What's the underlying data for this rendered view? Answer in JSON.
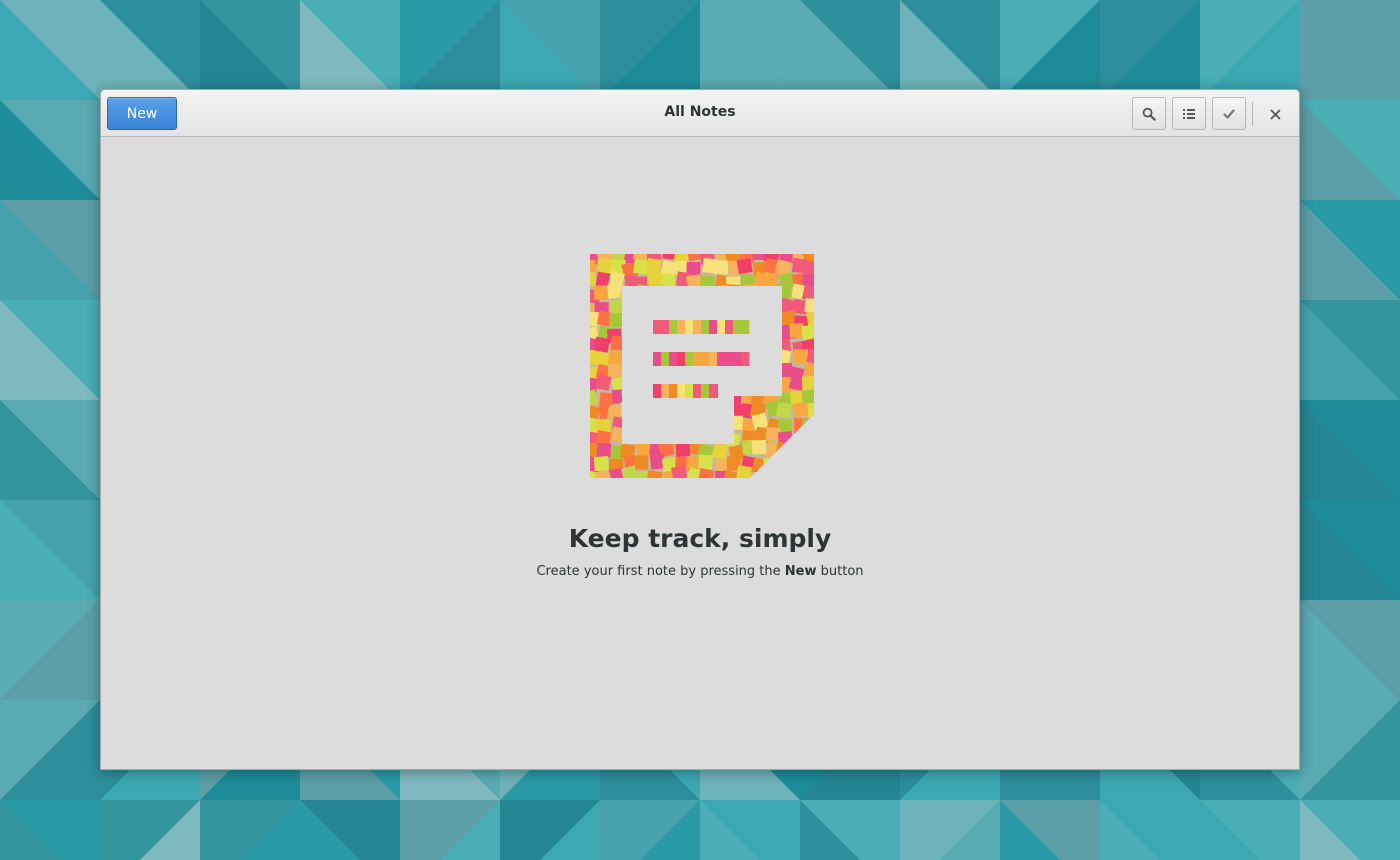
{
  "window": {
    "title": "All Notes"
  },
  "headerbar": {
    "new_label": "New",
    "buttons": [
      {
        "id": "search",
        "icon": "search-icon"
      },
      {
        "id": "view",
        "icon": "list-view-icon"
      },
      {
        "id": "select",
        "icon": "checkmark-icon"
      },
      {
        "id": "close",
        "icon": "close-icon"
      }
    ]
  },
  "empty_state": {
    "illustration": "sticky-notes-collage-note-icon",
    "heading": "Keep track, simply",
    "subtitle_before": "Create your first note by pressing the ",
    "subtitle_bold": "New",
    "subtitle_after": " button"
  },
  "colors": {
    "accent": "#3a83d6",
    "content_bg": "#dcdcdc",
    "text": "#2e3436",
    "desktop": "#2a9aa6"
  }
}
